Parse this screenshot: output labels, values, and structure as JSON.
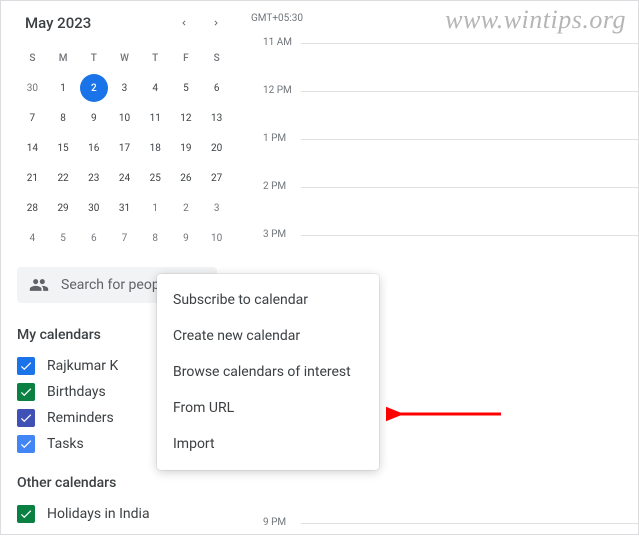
{
  "watermark": "www.wintips.org",
  "timezone": "GMT+05:30",
  "miniCal": {
    "title": "May 2023",
    "dow": [
      "S",
      "M",
      "T",
      "W",
      "T",
      "F",
      "S"
    ],
    "weeks": [
      [
        {
          "d": "30",
          "o": true
        },
        {
          "d": "1"
        },
        {
          "d": "2",
          "sel": true
        },
        {
          "d": "3"
        },
        {
          "d": "4"
        },
        {
          "d": "5"
        },
        {
          "d": "6"
        }
      ],
      [
        {
          "d": "7"
        },
        {
          "d": "8"
        },
        {
          "d": "9"
        },
        {
          "d": "10"
        },
        {
          "d": "11"
        },
        {
          "d": "12"
        },
        {
          "d": "13"
        }
      ],
      [
        {
          "d": "14"
        },
        {
          "d": "15"
        },
        {
          "d": "16"
        },
        {
          "d": "17"
        },
        {
          "d": "18"
        },
        {
          "d": "19"
        },
        {
          "d": "20"
        }
      ],
      [
        {
          "d": "21"
        },
        {
          "d": "22"
        },
        {
          "d": "23"
        },
        {
          "d": "24"
        },
        {
          "d": "25"
        },
        {
          "d": "26"
        },
        {
          "d": "27"
        }
      ],
      [
        {
          "d": "28"
        },
        {
          "d": "29"
        },
        {
          "d": "30"
        },
        {
          "d": "31"
        },
        {
          "d": "1",
          "o": true
        },
        {
          "d": "2",
          "o": true
        },
        {
          "d": "3",
          "o": true
        }
      ],
      [
        {
          "d": "4",
          "o": true
        },
        {
          "d": "5",
          "o": true
        },
        {
          "d": "6",
          "o": true
        },
        {
          "d": "7",
          "o": true
        },
        {
          "d": "8",
          "o": true
        },
        {
          "d": "9",
          "o": true
        },
        {
          "d": "10",
          "o": true
        }
      ]
    ]
  },
  "search": {
    "placeholder": "Search for people"
  },
  "sections": {
    "myCalendars": "My calendars",
    "otherCalendars": "Other calendars"
  },
  "myCalendars": [
    {
      "label": "Rajkumar K",
      "color": "#1a73e8"
    },
    {
      "label": "Birthdays",
      "color": "#0b8043"
    },
    {
      "label": "Reminders",
      "color": "#3f51b5"
    },
    {
      "label": "Tasks",
      "color": "#4285f4"
    }
  ],
  "otherCalendars": [
    {
      "label": "Holidays in India",
      "color": "#0b8043"
    }
  ],
  "hours": [
    "11 AM",
    "12 PM",
    "1 PM",
    "2 PM",
    "3 PM",
    "9 PM"
  ],
  "menu": {
    "items": [
      "Subscribe to calendar",
      "Create new calendar",
      "Browse calendars of interest",
      "From URL",
      "Import"
    ]
  }
}
